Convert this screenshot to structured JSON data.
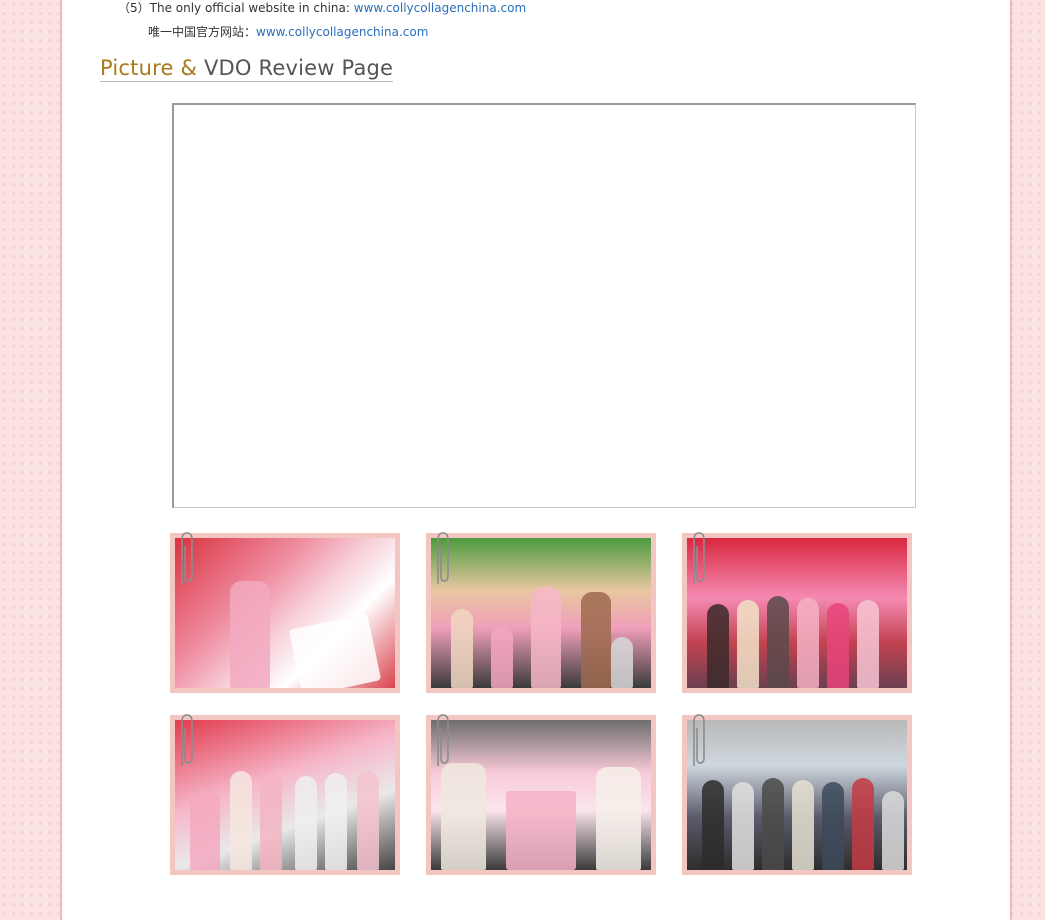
{
  "info": {
    "line1_prefix": "（5）The only official website in china: ",
    "line1_link": "www.collycollagenchina.com",
    "line2_prefix": "唯一中国官方网站：",
    "line2_link": "www.collycollagenchina.com"
  },
  "section": {
    "heading_part1": "Picture",
    "heading_amp": "&",
    "heading_part2": "VDO Review Page"
  },
  "gallery": {
    "photos": [
      {
        "name": "event-photo-1"
      },
      {
        "name": "event-photo-2"
      },
      {
        "name": "event-photo-3"
      },
      {
        "name": "event-photo-4"
      },
      {
        "name": "event-photo-5"
      },
      {
        "name": "event-photo-6"
      }
    ]
  },
  "colors": {
    "page_background": "#fbe3e4",
    "frame_pink": "#f4c6c3",
    "link_blue": "#2a6fbd",
    "heading_gold": "#a87a1a"
  },
  "icons": [
    "paperclip-icon"
  ]
}
